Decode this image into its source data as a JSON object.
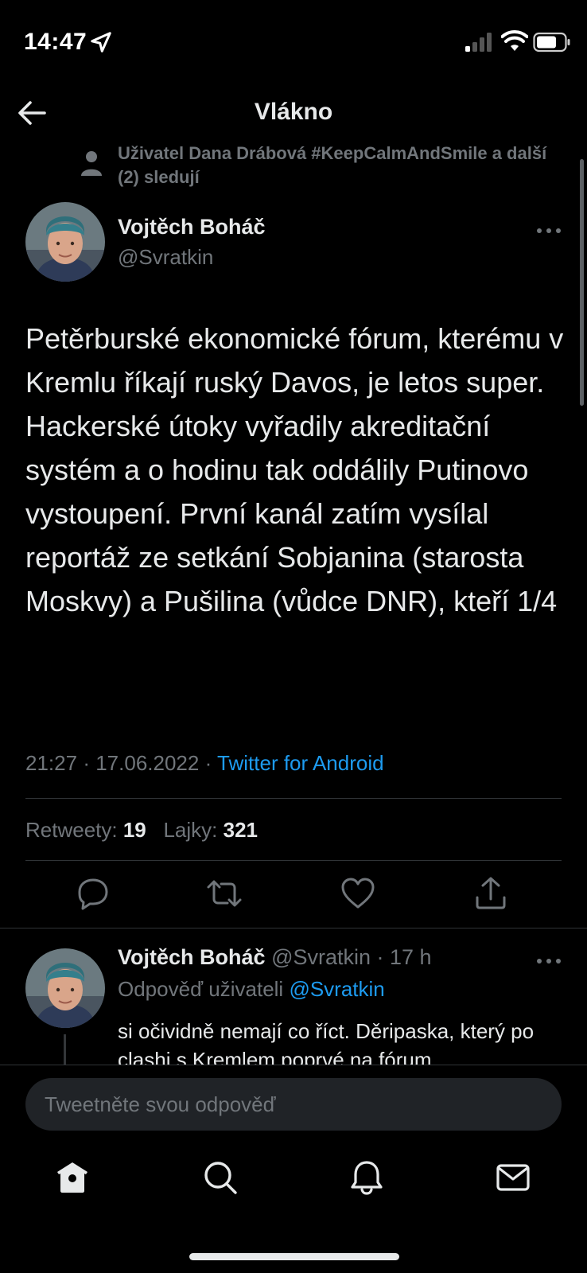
{
  "status_bar": {
    "time": "14:47"
  },
  "header": {
    "title": "Vlákno"
  },
  "social_context": {
    "text": "Uživatel Dana Drábová #KeepCalmAndSmile a další (2) sledují"
  },
  "main_tweet": {
    "author_name": "Vojtěch Boháč",
    "author_handle": "@Svratkin",
    "text": "Petěrburské ekonomické fórum, kterému v Kremlu říkají ruský Davos, je letos super. Hackerské útoky vyřadily akreditační systém a o hodinu tak oddálily Putinovo vystoupení. První kanál zatím vysílal reportáž ze setkání Sobjanina (starosta Moskvy) a Pušilina (vůdce DNR), kteří  1/4",
    "time": "21:27",
    "date": "17.06.2022",
    "meta_separator": "·",
    "source": "Twitter for Android",
    "retweets_label": "Retweety:",
    "retweets_count": "19",
    "likes_label": "Lajky:",
    "likes_count": "321"
  },
  "reply_tweet": {
    "author_name": "Vojtěch Boháč",
    "author_handle": "@Svratkin",
    "time_ago": "· 17 h",
    "reply_to_label": "Odpověď uživateli",
    "reply_to_handle": "@Svratkin",
    "text": "si očividně nemají co říct. Děripaska, který po clashi s Kremlem poprvé na fórum"
  },
  "compose": {
    "placeholder": "Tweetněte svou odpověď"
  },
  "icons": {
    "back": "arrow-left-icon",
    "more": "ellipsis-icon",
    "reply": "comment-icon",
    "retweet": "retweet-icon",
    "like": "heart-icon",
    "share": "share-icon",
    "home": "home-icon",
    "search": "search-icon",
    "notifications": "bell-icon",
    "messages": "mail-icon"
  },
  "colors": {
    "background": "#000000",
    "text_primary": "#e7e9ea",
    "text_secondary": "#71767b",
    "accent": "#1d9bf0",
    "divider": "#2f3336"
  }
}
